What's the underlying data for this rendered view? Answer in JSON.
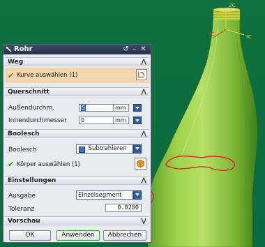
{
  "viewport": {
    "axis_labels": {
      "zc": "ZC",
      "yc": "YC",
      "xc": "XC"
    },
    "background_color": "#0d6b3c",
    "bottle_color": "#8bc83a",
    "annotation_color": "#e0232b"
  },
  "dialog": {
    "title": "Rohr",
    "title_buttons": [
      "reset",
      "minimize",
      "close"
    ],
    "sections": {
      "weg": {
        "header": "Weg",
        "select_curve_label": "Kurve auswählen (1)"
      },
      "querschnitt": {
        "header": "Querschnitt",
        "outer_label": "Außendurchm.",
        "outer_value": "5",
        "outer_unit": "mm",
        "inner_label": "Innendurchmesser",
        "inner_value": "0",
        "inner_unit": "mm"
      },
      "boolesch": {
        "header": "Boolesch",
        "bool_label": "Boolesch",
        "bool_value": "Subtrahieren",
        "select_body_label": "Körper auswählen (1)"
      },
      "einstellungen": {
        "header": "Einstellungen",
        "output_label": "Ausgabe",
        "output_value": "Einzelsegment",
        "tolerance_label": "Toleranz",
        "tolerance_value": "0.0200"
      },
      "vorschau": {
        "header": "Vorschau"
      }
    },
    "buttons": {
      "ok": "OK",
      "apply": "Anwenden",
      "cancel": "Abbrechen"
    }
  }
}
